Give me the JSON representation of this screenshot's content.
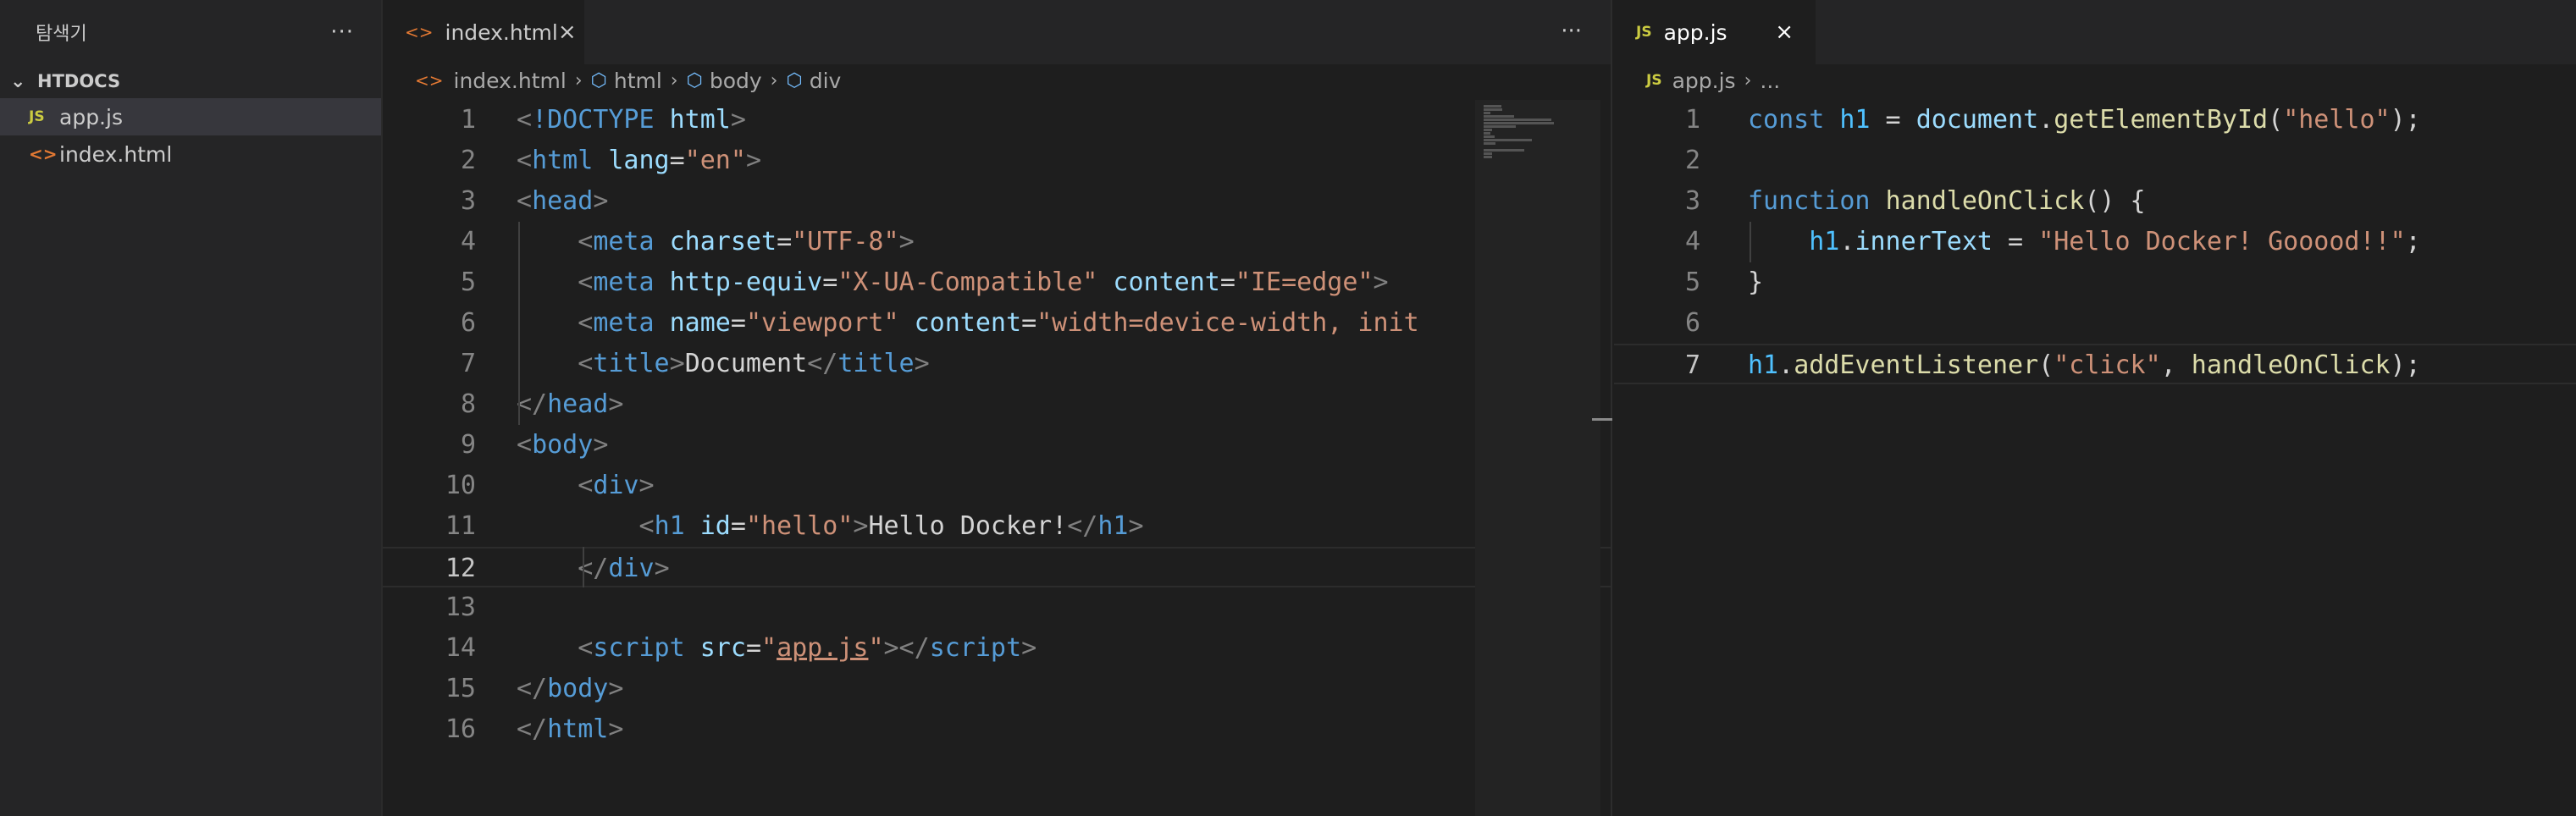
{
  "sidebar": {
    "title": "탐색기",
    "more": "···",
    "folder": "HTDOCS",
    "files": [
      {
        "name": "app.js",
        "icon": "js-file-icon",
        "icon_text": "JS",
        "selected": true
      },
      {
        "name": "index.html",
        "icon": "html-file-icon",
        "icon_text": "<>",
        "selected": false
      }
    ]
  },
  "left_editor": {
    "tab_label": "index.html",
    "tab_icon_text": "<>",
    "close": "×",
    "actions": "···",
    "breadcrumb": [
      "index.html",
      "html",
      "body",
      "div"
    ],
    "active_line": 12
  },
  "right_editor": {
    "tab_label": "app.js",
    "tab_icon_text": "JS",
    "close": "×",
    "breadcrumb": [
      "app.js",
      "..."
    ],
    "active_line": 7
  },
  "colors": {
    "background": "#1e1e1e",
    "sidebar": "#252526",
    "keyword": "#569cd6",
    "string": "#ce9178",
    "attribute": "#9cdcfe",
    "function": "#dcdcaa"
  },
  "html_code": [
    {
      "n": "1",
      "tokens": [
        [
          "punc",
          "<"
        ],
        [
          "tag",
          "!DOCTYPE"
        ],
        [
          "txt",
          " "
        ],
        [
          "attr",
          "html"
        ],
        [
          "punc",
          ">"
        ]
      ]
    },
    {
      "n": "2",
      "tokens": [
        [
          "punc",
          "<"
        ],
        [
          "tag",
          "html"
        ],
        [
          "txt",
          " "
        ],
        [
          "attr",
          "lang"
        ],
        [
          "txt",
          "="
        ],
        [
          "str",
          "\"en\""
        ],
        [
          "punc",
          ">"
        ]
      ]
    },
    {
      "n": "3",
      "tokens": [
        [
          "punc",
          "<"
        ],
        [
          "tag",
          "head"
        ],
        [
          "punc",
          ">"
        ]
      ]
    },
    {
      "n": "4",
      "tokens": [
        [
          "txt",
          "    "
        ],
        [
          "punc",
          "<"
        ],
        [
          "tag",
          "meta"
        ],
        [
          "txt",
          " "
        ],
        [
          "attr",
          "charset"
        ],
        [
          "txt",
          "="
        ],
        [
          "str",
          "\"UTF-8\""
        ],
        [
          "punc",
          ">"
        ]
      ]
    },
    {
      "n": "5",
      "tokens": [
        [
          "txt",
          "    "
        ],
        [
          "punc",
          "<"
        ],
        [
          "tag",
          "meta"
        ],
        [
          "txt",
          " "
        ],
        [
          "attr",
          "http-equiv"
        ],
        [
          "txt",
          "="
        ],
        [
          "str",
          "\"X-UA-Compatible\""
        ],
        [
          "txt",
          " "
        ],
        [
          "attr",
          "content"
        ],
        [
          "txt",
          "="
        ],
        [
          "str",
          "\"IE=edge\""
        ],
        [
          "punc",
          ">"
        ]
      ]
    },
    {
      "n": "6",
      "tokens": [
        [
          "txt",
          "    "
        ],
        [
          "punc",
          "<"
        ],
        [
          "tag",
          "meta"
        ],
        [
          "txt",
          " "
        ],
        [
          "attr",
          "name"
        ],
        [
          "txt",
          "="
        ],
        [
          "str",
          "\"viewport\""
        ],
        [
          "txt",
          " "
        ],
        [
          "attr",
          "content"
        ],
        [
          "txt",
          "="
        ],
        [
          "str",
          "\"width=device-width, init"
        ]
      ]
    },
    {
      "n": "7",
      "tokens": [
        [
          "txt",
          "    "
        ],
        [
          "punc",
          "<"
        ],
        [
          "tag",
          "title"
        ],
        [
          "punc",
          ">"
        ],
        [
          "txt",
          "Document"
        ],
        [
          "punc",
          "</"
        ],
        [
          "tag",
          "title"
        ],
        [
          "punc",
          ">"
        ]
      ]
    },
    {
      "n": "8",
      "tokens": [
        [
          "punc",
          "</"
        ],
        [
          "tag",
          "head"
        ],
        [
          "punc",
          ">"
        ]
      ]
    },
    {
      "n": "9",
      "tokens": [
        [
          "punc",
          "<"
        ],
        [
          "tag",
          "body"
        ],
        [
          "punc",
          ">"
        ]
      ]
    },
    {
      "n": "10",
      "tokens": [
        [
          "txt",
          "    "
        ],
        [
          "punc",
          "<"
        ],
        [
          "tag",
          "div"
        ],
        [
          "punc",
          ">"
        ]
      ]
    },
    {
      "n": "11",
      "tokens": [
        [
          "txt",
          "        "
        ],
        [
          "punc",
          "<"
        ],
        [
          "tag",
          "h1"
        ],
        [
          "txt",
          " "
        ],
        [
          "attr",
          "id"
        ],
        [
          "txt",
          "="
        ],
        [
          "str",
          "\"hello\""
        ],
        [
          "punc",
          ">"
        ],
        [
          "txt",
          "Hello Docker!"
        ],
        [
          "punc",
          "</"
        ],
        [
          "tag",
          "h1"
        ],
        [
          "punc",
          ">"
        ]
      ]
    },
    {
      "n": "12",
      "tokens": [
        [
          "txt",
          "    "
        ],
        [
          "punc",
          "</"
        ],
        [
          "tag",
          "div"
        ],
        [
          "punc",
          ">"
        ]
      ]
    },
    {
      "n": "13",
      "tokens": []
    },
    {
      "n": "14",
      "tokens": [
        [
          "txt",
          "    "
        ],
        [
          "punc",
          "<"
        ],
        [
          "tag",
          "script"
        ],
        [
          "txt",
          " "
        ],
        [
          "attr",
          "src"
        ],
        [
          "txt",
          "="
        ],
        [
          "str",
          "\""
        ],
        [
          "str link",
          "app.js"
        ],
        [
          "str",
          "\""
        ],
        [
          "punc",
          "></"
        ],
        [
          "tag",
          "script"
        ],
        [
          "punc",
          ">"
        ]
      ]
    },
    {
      "n": "15",
      "tokens": [
        [
          "punc",
          "</"
        ],
        [
          "tag",
          "body"
        ],
        [
          "punc",
          ">"
        ]
      ]
    },
    {
      "n": "16",
      "tokens": [
        [
          "punc",
          "</"
        ],
        [
          "tag",
          "html"
        ],
        [
          "punc",
          ">"
        ]
      ]
    }
  ],
  "js_code": [
    {
      "n": "1",
      "tokens": [
        [
          "kw",
          "const"
        ],
        [
          "txt",
          " "
        ],
        [
          "var",
          "h1"
        ],
        [
          "txt",
          " = "
        ],
        [
          "prop",
          "document"
        ],
        [
          "txt",
          "."
        ],
        [
          "fn",
          "getElementById"
        ],
        [
          "txt",
          "("
        ],
        [
          "str",
          "\"hello\""
        ],
        [
          "txt",
          ");"
        ]
      ]
    },
    {
      "n": "2",
      "tokens": []
    },
    {
      "n": "3",
      "tokens": [
        [
          "kw",
          "function"
        ],
        [
          "txt",
          " "
        ],
        [
          "fn",
          "handleOnClick"
        ],
        [
          "txt",
          "() {"
        ]
      ]
    },
    {
      "n": "4",
      "tokens": [
        [
          "txt",
          "    "
        ],
        [
          "var",
          "h1"
        ],
        [
          "txt",
          "."
        ],
        [
          "prop",
          "innerText"
        ],
        [
          "txt",
          " = "
        ],
        [
          "str",
          "\"Hello Docker! Gooood!!\""
        ],
        [
          "txt",
          ";"
        ]
      ]
    },
    {
      "n": "5",
      "tokens": [
        [
          "txt",
          "}"
        ]
      ]
    },
    {
      "n": "6",
      "tokens": []
    },
    {
      "n": "7",
      "tokens": [
        [
          "var",
          "h1"
        ],
        [
          "txt",
          "."
        ],
        [
          "fn",
          "addEventListener"
        ],
        [
          "txt",
          "("
        ],
        [
          "str",
          "\"click\""
        ],
        [
          "txt",
          ", "
        ],
        [
          "fn",
          "handleOnClick"
        ],
        [
          "txt",
          ");"
        ]
      ]
    }
  ]
}
